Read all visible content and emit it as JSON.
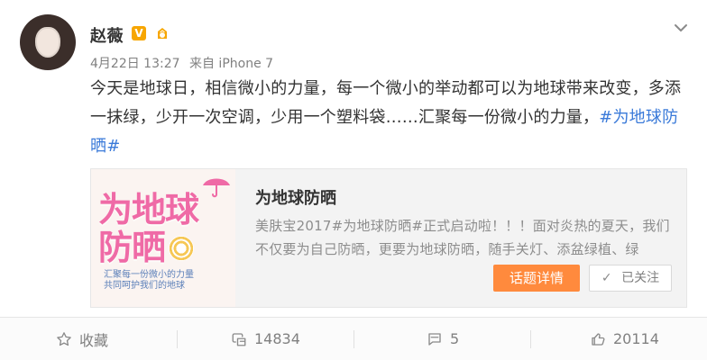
{
  "post": {
    "user": {
      "name": "赵薇",
      "verified_badge": "V",
      "icons": [
        "avatar",
        "verified-badge",
        "member-badge-icon",
        "chevron-down-icon"
      ]
    },
    "meta": {
      "time": "4月22日 13:27",
      "source_label": "来自 iPhone 7"
    },
    "content": {
      "text_main": "今天是地球日，相信微小的力量，每一个微小的举动都可以为地球带来改变，多添一抹绿，少开一次空调，少用一个塑料袋……汇聚每一份微小的力量，",
      "hashtag": "#为地球防晒#"
    },
    "card": {
      "title": "为地球防晒",
      "description": "美肤宝2017#为地球防晒#正式启动啦！！！面对炎热的夏天，我们不仅要为自己防晒，更要为地球防晒，随手关灯、添盆绿植、绿",
      "buttons": {
        "topic_details": "话题详情",
        "followed": "已关注"
      },
      "poster": {
        "title": "为地球防晒",
        "subtitle_line1": "汇聚每一份微小的力量",
        "subtitle_line2": "共同呵护我们的地球"
      }
    },
    "actions": {
      "favorite": "收藏",
      "reposts": "14834",
      "comments": "5",
      "likes": "20114"
    },
    "colors": {
      "accent_orange": "#ff8a3d",
      "link_blue": "#3a7ad9",
      "poster_pink": "#ef6aa6"
    }
  }
}
